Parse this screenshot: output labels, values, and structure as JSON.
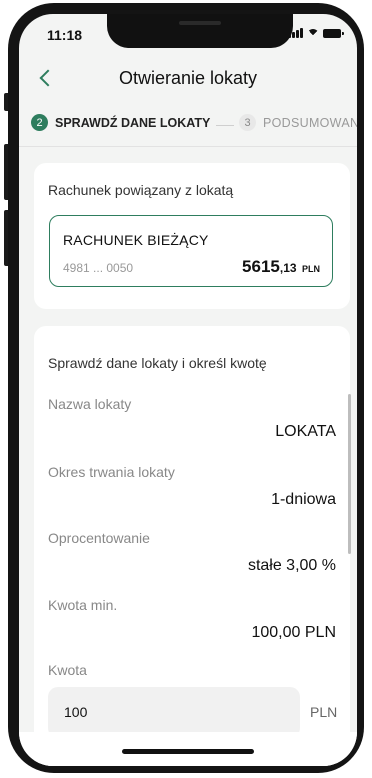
{
  "status_bar": {
    "time": "11:18"
  },
  "header": {
    "title": "Otwieranie lokaty"
  },
  "steps": [
    {
      "number": "2",
      "label": "SPRAWDŹ DANE LOKATY",
      "active": true
    },
    {
      "number": "3",
      "label": "PODSUMOWANIE",
      "active": false
    }
  ],
  "account_section": {
    "title": "Rachunek powiązany z lokatą",
    "account": {
      "name": "RACHUNEK BIEŻĄCY",
      "number": "4981 ... 0050",
      "balance_main": "5615",
      "balance_decimal": ",13",
      "currency": "PLN"
    }
  },
  "deposit_section": {
    "title": "Sprawdź dane lokaty i określ kwotę",
    "fields": [
      {
        "label": "Nazwa lokaty",
        "value": "LOKATA"
      },
      {
        "label": "Okres trwania lokaty",
        "value": "1-dniowa"
      },
      {
        "label": "Oprocentowanie",
        "value": "stałe 3,00 %"
      },
      {
        "label": "Kwota min.",
        "value": "100,00 PLN"
      }
    ],
    "amount": {
      "label": "Kwota",
      "value": "100",
      "currency": "PLN"
    }
  },
  "colors": {
    "accent": "#2e7d5e",
    "background": "#f3f4f3",
    "card": "#ffffff"
  },
  "icons": [
    "back-chevron-icon",
    "signal-icon",
    "wifi-icon",
    "battery-icon"
  ]
}
